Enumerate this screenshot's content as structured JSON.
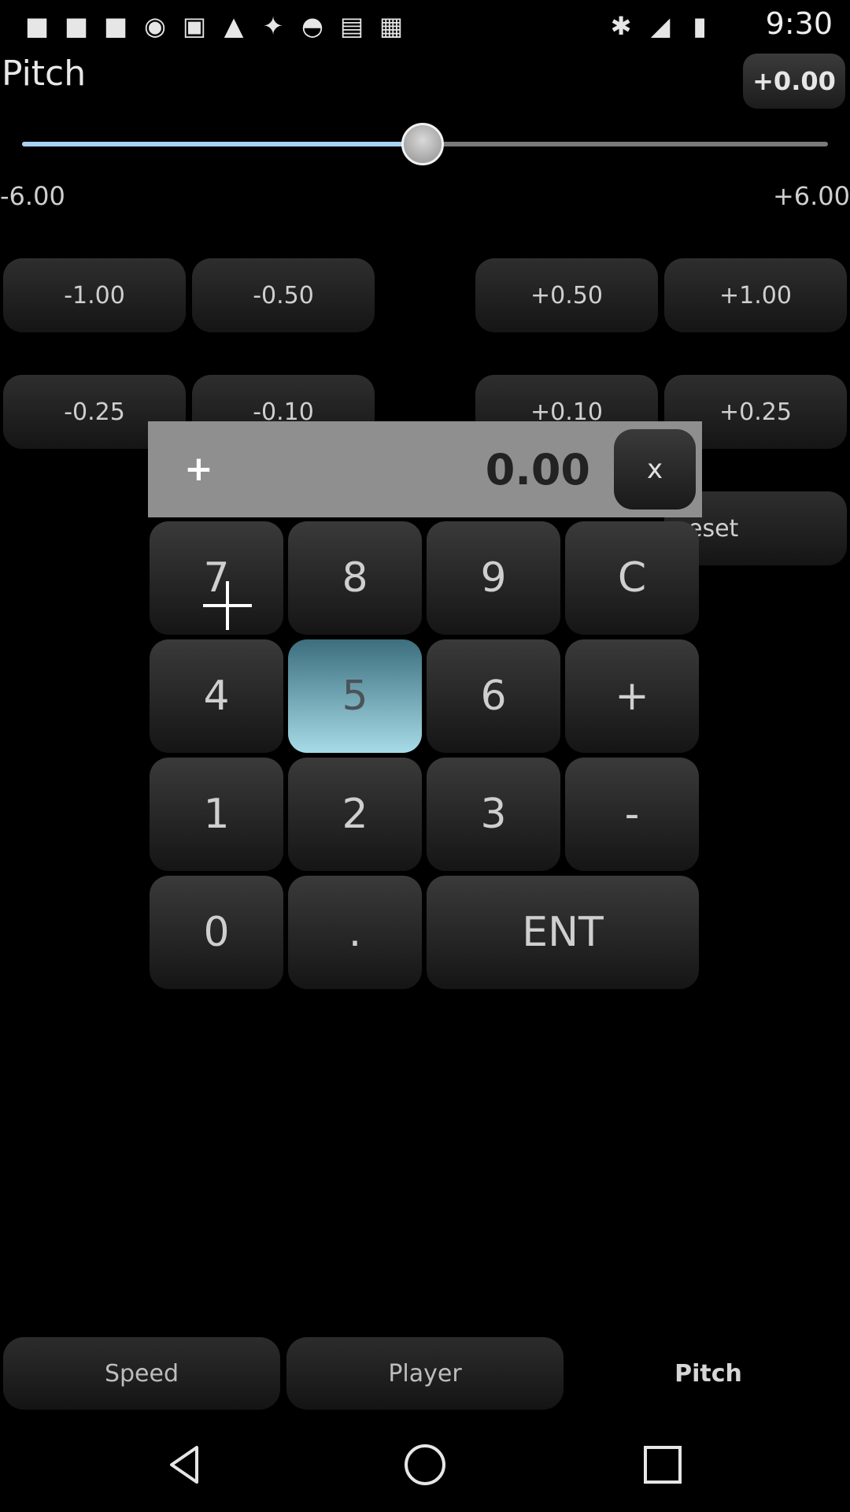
{
  "status_bar": {
    "time": "9:30",
    "icons": [
      "app-icon",
      "app-icon",
      "app-icon",
      "sync-icon",
      "lock-icon",
      "warning-icon",
      "fake-gps-icon",
      "android-icon",
      "inbox-icon",
      "bag-icon",
      "bluetooth-icon",
      "signal-icon",
      "battery-icon"
    ]
  },
  "header": {
    "title": "Pitch",
    "current_value": "+0.00"
  },
  "slider": {
    "min_label": "-6.00",
    "max_label": "+6.00",
    "value": 0.0,
    "min": -6.0,
    "max": 6.0
  },
  "step_buttons": {
    "row1": [
      "-1.00",
      "-0.50",
      "+0.50",
      "+1.00"
    ],
    "row2": [
      "-0.25",
      "-0.10",
      "+0.10",
      "+0.25"
    ],
    "reset_partial": "eset"
  },
  "keypad": {
    "sign": "+",
    "display_value": "0.00",
    "close_label": "x",
    "keys": {
      "k7": "7",
      "k8": "8",
      "k9": "9",
      "kc": "C",
      "k4": "4",
      "k5": "5",
      "k6": "6",
      "kplus": "+",
      "k1": "1",
      "k2": "2",
      "k3": "3",
      "kminus": "-",
      "k0": "0",
      "kdot": ".",
      "kent": "ENT"
    },
    "active_key": "5"
  },
  "bottom_tabs": {
    "speed": "Speed",
    "player": "Player",
    "pitch": "Pitch",
    "selected": "Pitch"
  },
  "nav": [
    "back-icon",
    "home-icon",
    "recents-icon"
  ]
}
